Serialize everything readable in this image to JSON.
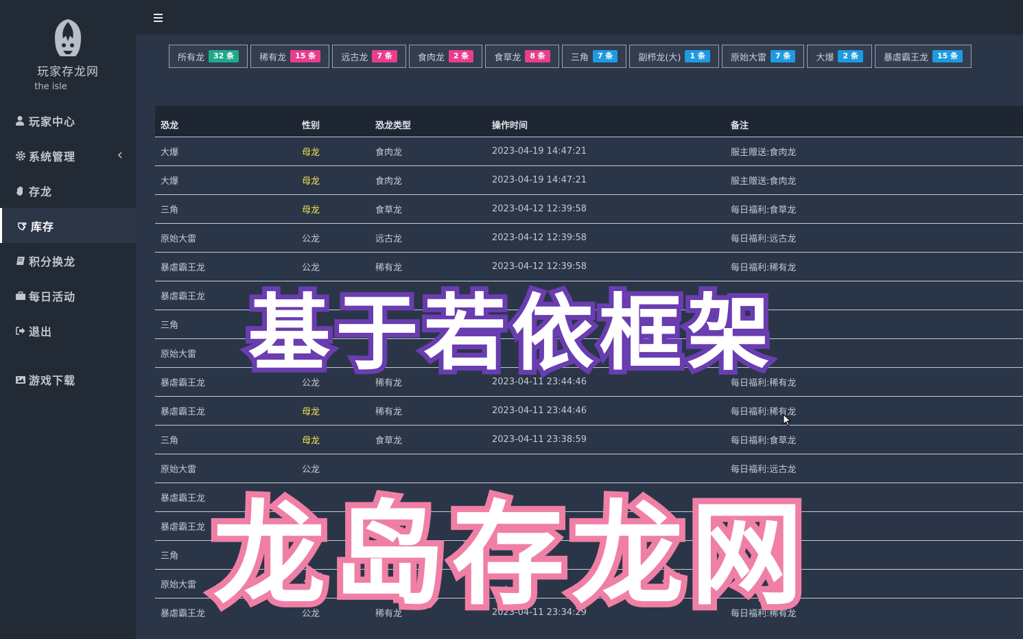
{
  "sidebar": {
    "logo_title": "玩家存龙网",
    "logo_sub": "the isle",
    "items": [
      {
        "label": "玩家中心",
        "icon": "user-icon"
      },
      {
        "label": "系统管理",
        "icon": "gear-icon"
      },
      {
        "label": "存龙",
        "icon": "hand-icon"
      },
      {
        "label": "库存",
        "icon": "hand-pointer-icon"
      },
      {
        "label": "积分换龙",
        "icon": "book-icon"
      },
      {
        "label": "每日活动",
        "icon": "briefcase-icon"
      },
      {
        "label": "退出",
        "icon": "sign-out-icon"
      },
      {
        "label": "游戏下载",
        "icon": "image-icon"
      }
    ]
  },
  "filters": [
    {
      "label": "所有龙",
      "badge": "32 条",
      "color": "#1fab89"
    },
    {
      "label": "稀有龙",
      "badge": "15 条",
      "color": "#e83e8c"
    },
    {
      "label": "远古龙",
      "badge": "7 条",
      "color": "#e83e8c"
    },
    {
      "label": "食肉龙",
      "badge": "2 条",
      "color": "#e83e8c"
    },
    {
      "label": "食草龙",
      "badge": "8 条",
      "color": "#e83e8c"
    },
    {
      "label": "三角",
      "badge": "7 条",
      "color": "#1e9be0"
    },
    {
      "label": "副栉龙(大)",
      "badge": "1 条",
      "color": "#1e9be0"
    },
    {
      "label": "原始大雷",
      "badge": "7 条",
      "color": "#1e9be0"
    },
    {
      "label": "大爆",
      "badge": "2 条",
      "color": "#1e9be0"
    },
    {
      "label": "暴虐霸王龙",
      "badge": "15 条",
      "color": "#1e9be0"
    }
  ],
  "table": {
    "headers": [
      "恐龙",
      "性别",
      "恐龙类型",
      "操作时间",
      "备注"
    ],
    "rows": [
      [
        "大爆",
        "母龙",
        "食肉龙",
        "2023-04-19 14:47:21",
        "服主赠送:食肉龙"
      ],
      [
        "大爆",
        "母龙",
        "食肉龙",
        "2023-04-19 14:47:21",
        "服主赠送:食肉龙"
      ],
      [
        "三角",
        "母龙",
        "食草龙",
        "2023-04-12 12:39:58",
        "每日福利:食草龙"
      ],
      [
        "原始大雷",
        "公龙",
        "远古龙",
        "2023-04-12 12:39:58",
        "每日福利:远古龙"
      ],
      [
        "暴虐霸王龙",
        "公龙",
        "稀有龙",
        "2023-04-12 12:39:58",
        "每日福利:稀有龙"
      ],
      [
        "暴虐霸王龙",
        "",
        "",
        "",
        ""
      ],
      [
        "三角",
        "",
        "",
        "",
        ""
      ],
      [
        "原始大雷",
        "",
        "",
        "",
        ""
      ],
      [
        "暴虐霸王龙",
        "公龙",
        "稀有龙",
        "2023-04-11 23:44:46",
        "每日福利:稀有龙"
      ],
      [
        "暴虐霸王龙",
        "母龙",
        "稀有龙",
        "2023-04-11 23:44:46",
        "每日福利:稀有龙"
      ],
      [
        "三角",
        "母龙",
        "食草龙",
        "2023-04-11 23:38:59",
        "每日福利:食草龙"
      ],
      [
        "原始大雷",
        "公龙",
        "",
        "",
        "每日福利:远古龙"
      ],
      [
        "暴虐霸王龙",
        "",
        "",
        "",
        ""
      ],
      [
        "暴虐霸王龙",
        "",
        "",
        "",
        ""
      ],
      [
        "三角",
        "",
        "",
        "",
        ""
      ],
      [
        "原始大雷",
        "",
        "",
        "",
        ""
      ],
      [
        "暴虐霸王龙",
        "公龙",
        "稀有龙",
        "2023-04-11 23:34:29",
        "每日福利:稀有龙"
      ]
    ]
  },
  "overlay": {
    "line1": "基于若依框架",
    "line2": "龙岛存龙网"
  }
}
